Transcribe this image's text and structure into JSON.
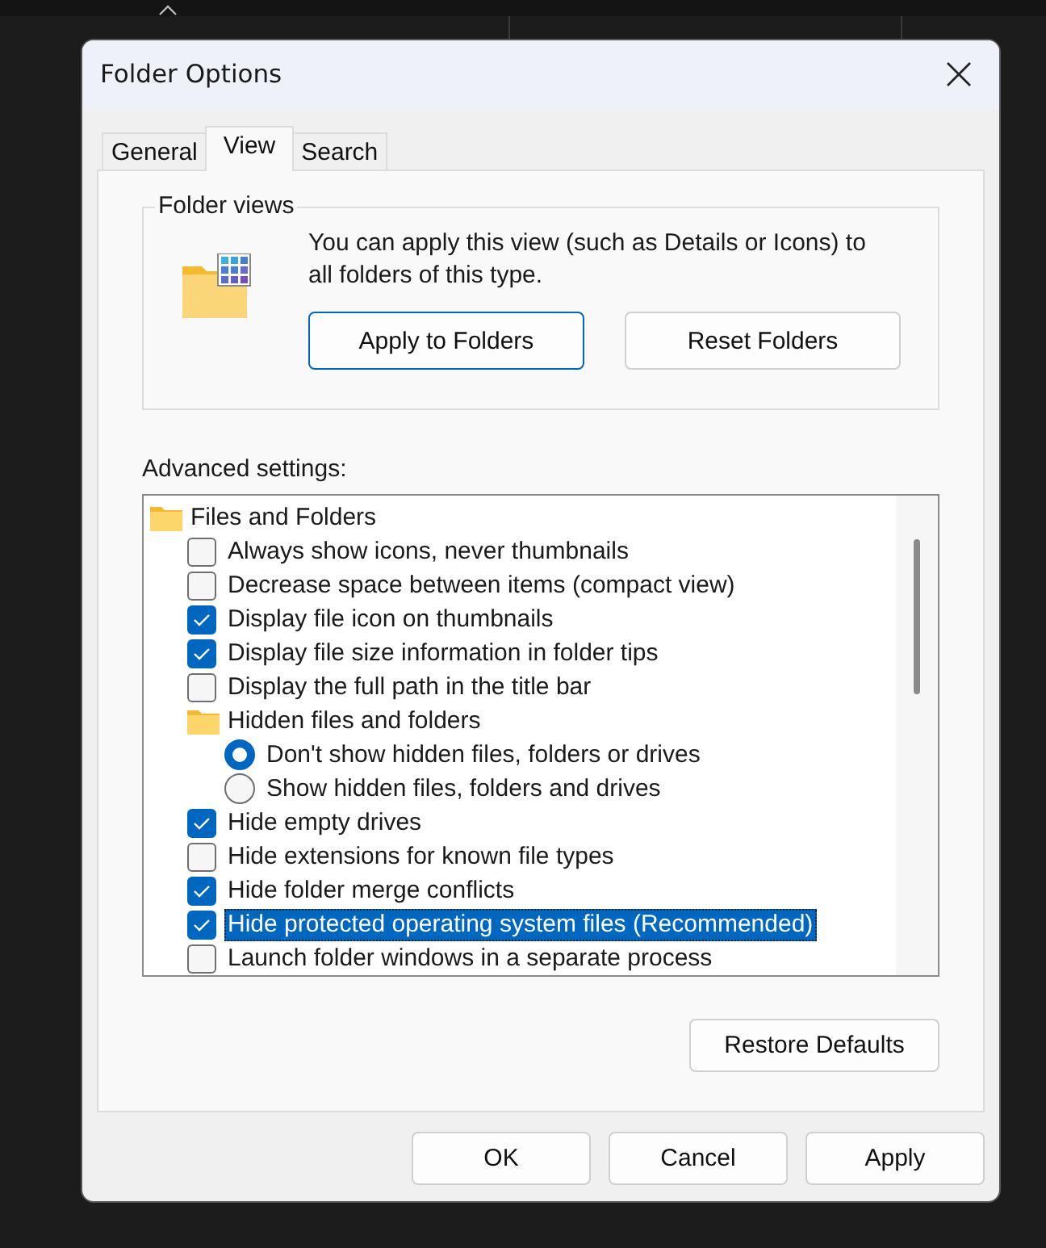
{
  "window": {
    "title": "Folder Options"
  },
  "tabs": [
    {
      "label": "General",
      "selected": false
    },
    {
      "label": "View",
      "selected": true
    },
    {
      "label": "Search",
      "selected": false
    }
  ],
  "folder_views": {
    "title": "Folder views",
    "description": "You can apply this view (such as Details or Icons) to all folders of this type.",
    "buttons": [
      {
        "label": "Apply to Folders",
        "focused": true
      },
      {
        "label": "Reset Folders",
        "focused": false
      }
    ]
  },
  "advanced_settings": {
    "label": "Advanced settings:",
    "items": [
      {
        "kind": "group",
        "label": "Files and Folders",
        "children": [
          {
            "kind": "checkbox",
            "label": "Always show icons, never thumbnails",
            "checked": false,
            "selected": false
          },
          {
            "kind": "checkbox",
            "label": "Decrease space between items (compact view)",
            "checked": false,
            "selected": false
          },
          {
            "kind": "checkbox",
            "label": "Display file icon on thumbnails",
            "checked": true,
            "selected": false
          },
          {
            "kind": "checkbox",
            "label": "Display file size information in folder tips",
            "checked": true,
            "selected": false
          },
          {
            "kind": "checkbox",
            "label": "Display the full path in the title bar",
            "checked": false,
            "selected": false
          },
          {
            "kind": "group",
            "label": "Hidden files and folders",
            "children": [
              {
                "kind": "radio",
                "label": "Don't show hidden files, folders or drives",
                "checked": true,
                "selected": false
              },
              {
                "kind": "radio",
                "label": "Show hidden files, folders and drives",
                "checked": false,
                "selected": false
              }
            ]
          },
          {
            "kind": "checkbox",
            "label": "Hide empty drives",
            "checked": true,
            "selected": false
          },
          {
            "kind": "checkbox",
            "label": "Hide extensions for known file types",
            "checked": false,
            "selected": false
          },
          {
            "kind": "checkbox",
            "label": "Hide folder merge conflicts",
            "checked": true,
            "selected": false
          },
          {
            "kind": "checkbox",
            "label": "Hide protected operating system files (Recommended)",
            "checked": true,
            "selected": true
          },
          {
            "kind": "checkbox",
            "label": "Launch folder windows in a separate process",
            "checked": false,
            "selected": false
          }
        ]
      }
    ]
  },
  "restore_button": "Restore Defaults",
  "buttons": [
    "OK",
    "Cancel",
    "Apply"
  ]
}
